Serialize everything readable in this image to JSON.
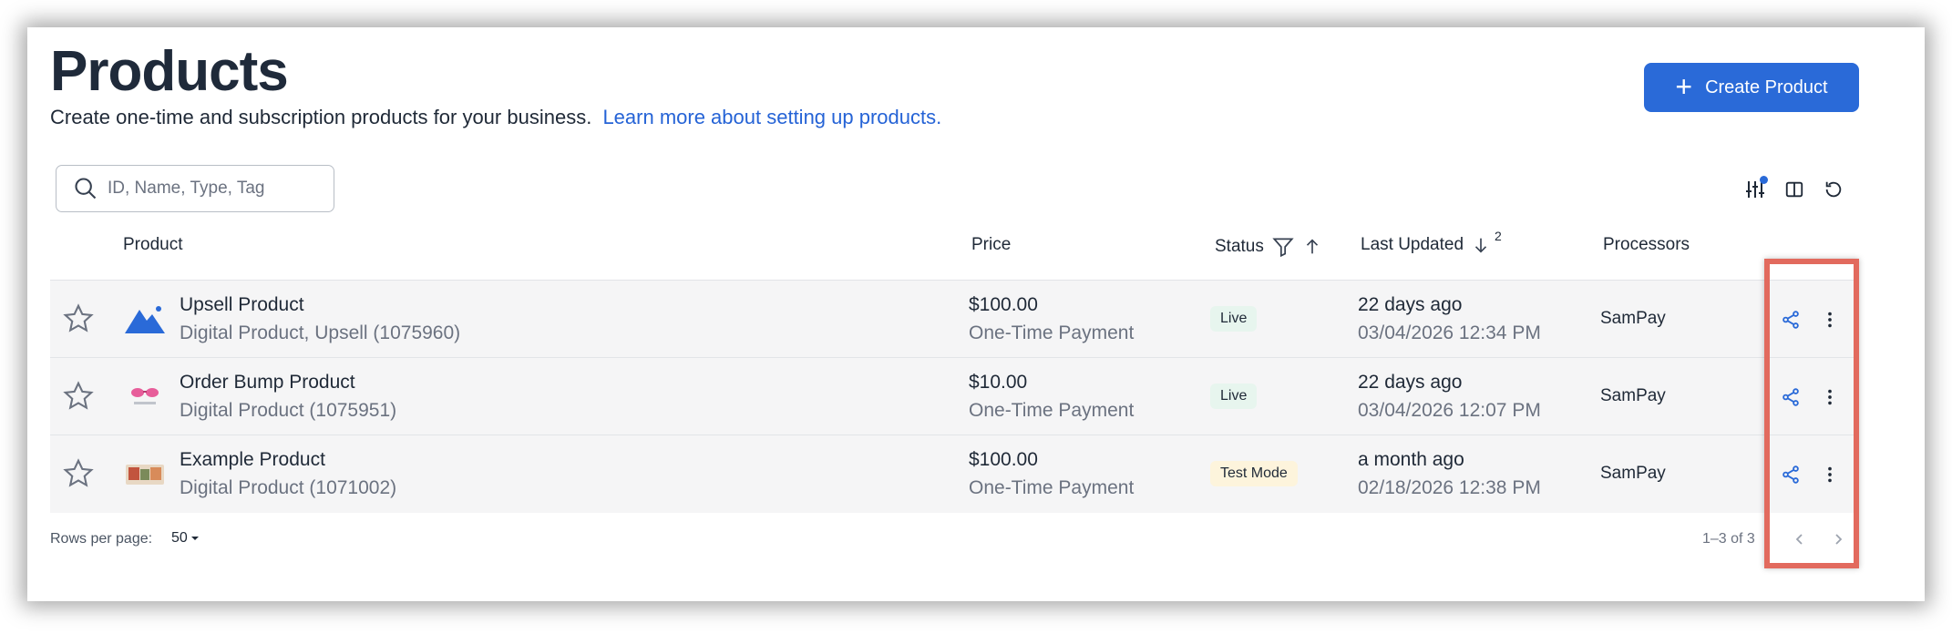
{
  "header": {
    "title": "Products",
    "subtitle": "Create one-time and subscription products for your business.",
    "learn_more_link": "Learn more about setting up products.",
    "create_button_label": "Create Product"
  },
  "search": {
    "placeholder": "ID, Name, Type, Tag"
  },
  "toolbar": {
    "icons": [
      "filter-sliders-icon",
      "columns-icon",
      "refresh-icon"
    ],
    "accent": "#2a6ad8"
  },
  "table": {
    "columns": {
      "product": "Product",
      "price": "Price",
      "status": "Status",
      "last_updated": "Last Updated",
      "last_updated_sort_order": "2",
      "processors": "Processors"
    },
    "rows": [
      {
        "name": "Upsell Product",
        "subtitle": "Digital Product, Upsell  (1075960)",
        "price": "$100.00",
        "payment_type": "One-Time Payment",
        "status": "Live",
        "updated_relative": "22 days ago",
        "updated_date": "03/04/2026 12:34 PM",
        "processor": "SamPay",
        "thumb": "mountain-icon"
      },
      {
        "name": "Order Bump Product",
        "subtitle": "Digital Product  (1075951)",
        "price": "$10.00",
        "payment_type": "One-Time Payment",
        "status": "Live",
        "updated_relative": "22 days ago",
        "updated_date": "03/04/2026 12:07 PM",
        "processor": "SamPay",
        "thumb": "sunglasses-image"
      },
      {
        "name": "Example Product",
        "subtitle": "Digital Product  (1071002)",
        "price": "$100.00",
        "payment_type": "One-Time Payment",
        "status": "Test Mode",
        "updated_relative": "a month ago",
        "updated_date": "02/18/2026 12:38 PM",
        "processor": "SamPay",
        "thumb": "product-photo"
      }
    ]
  },
  "footer": {
    "rows_per_page_label": "Rows per page:",
    "rows_per_page_value": "50",
    "range": "1–3 of 3"
  },
  "colors": {
    "primary": "#2a6ad8",
    "link": "#2563d6",
    "live_badge": "#e7f5ee",
    "test_badge": "#fdf4dc",
    "highlight": "#e26a5e"
  }
}
